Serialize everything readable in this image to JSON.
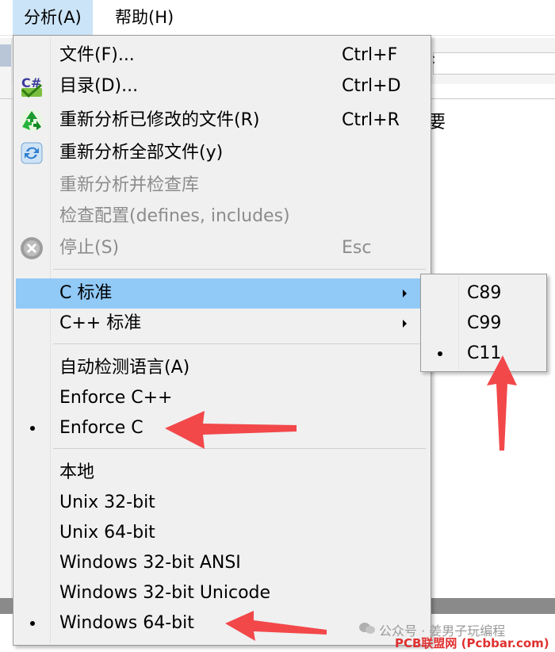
{
  "menubar": {
    "items": [
      {
        "label": "分析(A)"
      },
      {
        "label": "帮助(H)"
      }
    ]
  },
  "background": {
    "header_fragment": "要",
    "field_prefix": ":"
  },
  "menu": {
    "items": [
      {
        "label": "文件(F)...",
        "shortcut": "Ctrl+F"
      },
      {
        "label": "目录(D)...",
        "shortcut": "Ctrl+D",
        "icon": "csharp-folder-icon"
      },
      {
        "label": "重新分析已修改的文件(R)",
        "shortcut": "Ctrl+R",
        "icon": "recycle-icon"
      },
      {
        "label": "重新分析全部文件(y)",
        "icon": "refresh-icon"
      },
      {
        "label": "重新分析并检查库",
        "disabled": true
      },
      {
        "label": "检查配置(defines, includes)",
        "disabled": true
      },
      {
        "label": "停止(S)",
        "shortcut": "Esc",
        "disabled": true,
        "icon": "stop-icon"
      },
      {
        "label": "C 标准",
        "submenu": true,
        "highlighted": true
      },
      {
        "label": "C++ 标准",
        "submenu": true
      },
      {
        "label": "自动检测语言(A)"
      },
      {
        "label": "Enforce C++"
      },
      {
        "label": "Enforce C",
        "checked": true
      },
      {
        "label": "本地"
      },
      {
        "label": "Unix 32-bit"
      },
      {
        "label": "Unix 64-bit"
      },
      {
        "label": "Windows 32-bit ANSI"
      },
      {
        "label": "Windows 32-bit Unicode"
      },
      {
        "label": "Windows 64-bit",
        "checked": true
      }
    ]
  },
  "submenu_c_standard": {
    "items": [
      {
        "label": "C89"
      },
      {
        "label": "C99"
      },
      {
        "label": "C11",
        "checked": true
      }
    ]
  },
  "watermark": {
    "channel": "公众号 · 姜男子玩编程",
    "site": "PCB联盟网 (Pcbbar.com)"
  },
  "colors": {
    "highlight": "#91c9f7",
    "menubar_active": "#cce4f7",
    "arrow": "#f2484a"
  }
}
